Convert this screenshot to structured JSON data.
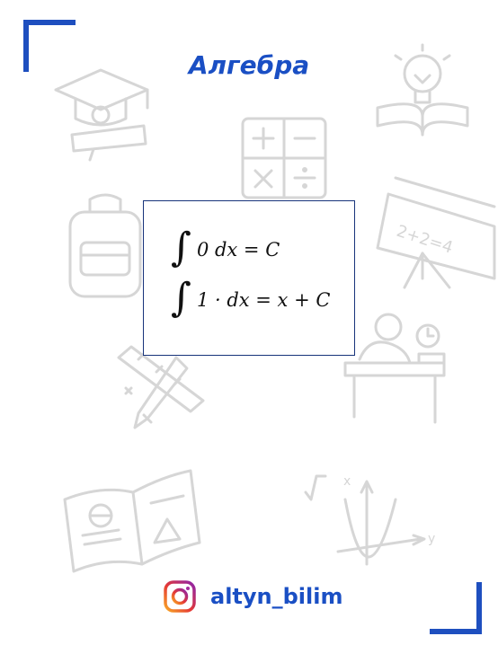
{
  "header": {
    "title": "Алгебра"
  },
  "formulas": {
    "line1": "0 dx = C",
    "line2": "1 · dx = x + C"
  },
  "decor": {
    "board_text": "2+2=4",
    "axis_x": "x",
    "axis_y": "y"
  },
  "footer": {
    "icon": "instagram-icon",
    "handle": "altyn_bilim"
  },
  "colors": {
    "accent": "#1e4fbf",
    "title": "#1a4fc4",
    "box_border": "#17337a",
    "doodles": "#d6d6d6"
  }
}
